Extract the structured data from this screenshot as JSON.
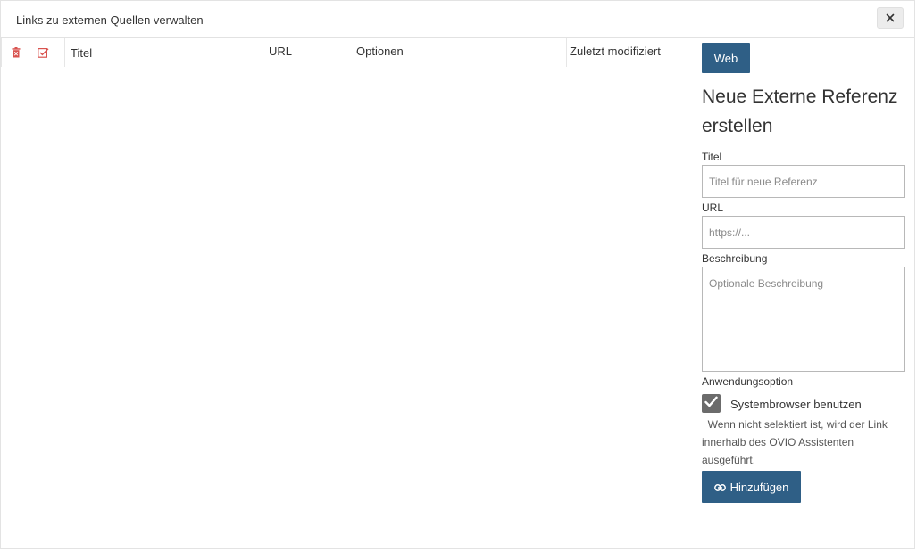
{
  "dialog": {
    "title": "Links zu externen Quellen verwalten",
    "close_icon": "close-icon",
    "close_symbol": "✕"
  },
  "table": {
    "header_icons": [
      "trash-icon",
      "check-square-icon"
    ],
    "columns": {
      "title": "Titel",
      "url": "URL",
      "options": "Optionen",
      "modified": "Zuletzt modifiziert"
    },
    "rows": []
  },
  "panel": {
    "web_button": "Web",
    "heading": "Neue Externe Referenz erstellen",
    "title_label": "Titel",
    "title_placeholder": "Titel für neue Referenz",
    "url_label": "URL",
    "url_placeholder": "https://...",
    "description_label": "Beschreibung",
    "description_placeholder": "Optionale Beschreibung",
    "option_label": "Anwendungsoption",
    "system_browser_label": "Systembrowser benutzen",
    "system_browser_checked": true,
    "hint": "  Wenn nicht selektiert ist, wird der Link innerhalb des OVIO Assistenten ausgeführt.",
    "add_button": "Hinzufügen",
    "add_icon": "link-icon"
  },
  "colors": {
    "primary": "#2f5f86",
    "danger": "#d9534f",
    "checkbox": "#6b6b6b"
  }
}
